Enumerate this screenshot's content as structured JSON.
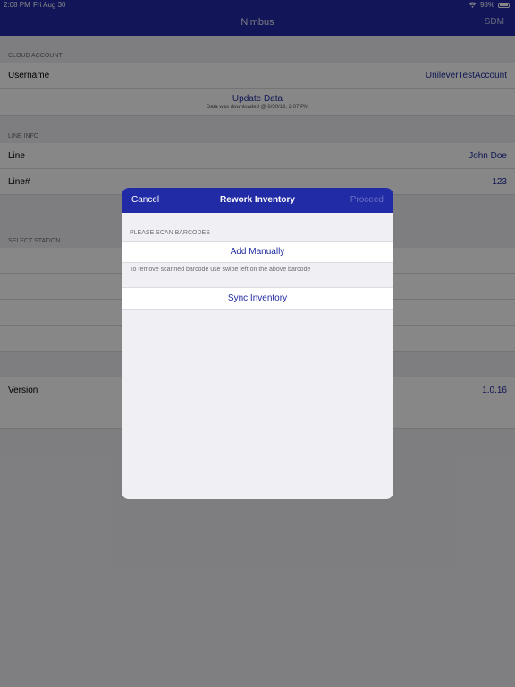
{
  "status_bar": {
    "time": "2:08 PM",
    "date": "Fri Aug 30",
    "battery": "98%"
  },
  "nav": {
    "title": "Nimbus",
    "right_button": "SDM"
  },
  "cloud_account": {
    "header": "CLOUD ACCOUNT",
    "username_label": "Username",
    "username_value": "UnileverTestAccount",
    "update_button": "Update Data",
    "update_subtext": "Data was downloaded @ 8/30/19, 2:07 PM"
  },
  "line_info": {
    "header": "LINE INFO",
    "line_label": "Line",
    "line_value": "John Doe",
    "line_no_label": "Line#",
    "line_no_value": "123"
  },
  "select_station": {
    "header": "SELECT STATION"
  },
  "version": {
    "label": "Version",
    "value": "1.0.16"
  },
  "modal": {
    "cancel": "Cancel",
    "title": "Rework Inventory",
    "proceed": "Proceed",
    "scan_header": "PLEASE SCAN BARCODES",
    "add_manually": "Add Manually",
    "hint": "To remove scanned barcode use swipe left on the above barcode",
    "sync_inventory": "Sync Inventory"
  }
}
